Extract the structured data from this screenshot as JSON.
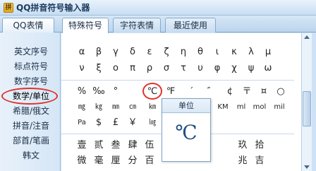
{
  "window": {
    "title": "QQ拼音符号输入器",
    "icon": "qq-pinyin-icon"
  },
  "left_tab": {
    "label": "QQ表情"
  },
  "tabs": [
    {
      "label": "特殊符号",
      "active": true
    },
    {
      "label": "字符表情",
      "active": false
    },
    {
      "label": "最近使用",
      "active": false
    }
  ],
  "categories": [
    "英文序号",
    "标点符号",
    "数字序号",
    "数学/单位",
    "希腊/俄文",
    "拼音/注音",
    "部首/笔画",
    "韩文"
  ],
  "selected_category": "数学/单位",
  "rows": [
    [
      "α",
      "β",
      "γ",
      "δ",
      "ε",
      "ζ",
      "η",
      "θ",
      "ι",
      "κ",
      "λ",
      "μ"
    ],
    [
      "ν",
      "ξ",
      "ο",
      "π",
      "ρ",
      "σ",
      "τ",
      "υ",
      "φ",
      "χ",
      "ψ",
      "ω"
    ],
    [
      "%",
      "‰",
      "°",
      "℃",
      "℉",
      "′",
      "″",
      "¢",
      "〒",
      "¤",
      "○"
    ],
    [
      "㎎",
      "㎏",
      "㎜",
      "㎝",
      "㎞",
      "",
      "",
      "",
      "",
      "KM",
      "ml",
      "mol",
      "mil"
    ],
    [
      "Pa",
      "$",
      "£",
      "￥",
      "㏒"
    ],
    [
      "壹",
      "贰",
      "叁",
      "肆",
      "伍",
      "",
      "",
      "",
      "",
      "",
      "玖",
      "拾"
    ],
    [
      "微",
      "毫",
      "厘",
      "分",
      "百",
      "",
      "",
      "",
      "",
      "",
      "兆",
      "吉"
    ]
  ],
  "preview": {
    "title": "单位",
    "symbol": "℃"
  }
}
